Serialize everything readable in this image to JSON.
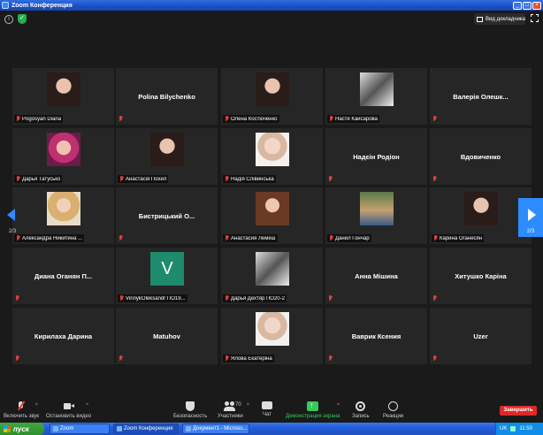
{
  "window": {
    "title": "Zoom Конференция"
  },
  "topbar": {
    "view_label": "Вид докладчика"
  },
  "tiles": [
    {
      "label": "Pogosyan Diana",
      "has_photo": true,
      "photo": "portrait-dark-hair"
    },
    {
      "label": "Polina Bilychenko",
      "has_photo": false
    },
    {
      "label": "Олена Костюченко",
      "has_photo": true,
      "photo": "portrait-dark-hair"
    },
    {
      "label": "Настя Кайсарова",
      "has_photo": true,
      "photo": "bw-portrait"
    },
    {
      "label": "Валерія Олешк...",
      "has_photo": false
    },
    {
      "label": "Дарья Татусько",
      "has_photo": true,
      "photo": "portrait-pink"
    },
    {
      "label": "Анастасія Похил",
      "has_photo": true,
      "photo": "portrait-dark-hair"
    },
    {
      "label": "Надія Слівинська",
      "has_photo": true,
      "photo": "portrait-light"
    },
    {
      "label": "Надєін Родіон",
      "has_photo": false
    },
    {
      "label": "Вдовиченко",
      "has_photo": false
    },
    {
      "label": "Александра Никитина ...",
      "has_photo": true,
      "photo": "portrait-blonde"
    },
    {
      "label": "Бистрицький О...",
      "has_photo": false
    },
    {
      "label": "Анастасия Лемеш",
      "has_photo": true,
      "photo": "portrait-brown-hair"
    },
    {
      "label": "Данил Гончар",
      "has_photo": true,
      "photo": "photo-room"
    },
    {
      "label": "Карина Оганесян",
      "has_photo": true,
      "photo": "portrait-dark-hair"
    },
    {
      "label": "Диана Оганян П...",
      "has_photo": false
    },
    {
      "label": "VinnykOleksandr ПО19...",
      "has_photo": true,
      "photo": "avatar-letter",
      "letter": "V"
    },
    {
      "label": "Дарья Дехтяр ПО20-2",
      "has_photo": true,
      "photo": "bw-portrait"
    },
    {
      "label": "Анна Мішина",
      "has_photo": false
    },
    {
      "label": "Хитушко Каріна",
      "has_photo": false
    },
    {
      "label": "Кирилаха Дарина",
      "has_photo": false
    },
    {
      "label": "Matuhov",
      "has_photo": false
    },
    {
      "label": "Ялова Екатеріна",
      "has_photo": true,
      "photo": "portrait-light"
    },
    {
      "label": "Ваврик Ксения",
      "has_photo": false
    },
    {
      "label": "Uzer",
      "has_photo": false
    }
  ],
  "pager": {
    "left_page": "2/3",
    "right_page": "2/3"
  },
  "toolbar": {
    "mic_label": "Включить звук",
    "video_label": "Остановить видео",
    "security_label": "Безопасность",
    "participants_label": "Участники",
    "participants_count": "70",
    "chat_label": "Чат",
    "share_label": "Демонстрация экрана",
    "record_label": "Запись",
    "reactions_label": "Реакции",
    "end_label": "Завершить"
  },
  "taskbar": {
    "start_label": "пуск",
    "tasks": [
      "Zoom",
      "Zoom Конференция",
      "Документ1 - Microso..."
    ],
    "lang": "UK",
    "clock": "11:50"
  },
  "colors": {
    "accent": "#2d8cff",
    "end": "#e02828",
    "share": "#36c95a",
    "muted": "#e23d3d"
  }
}
